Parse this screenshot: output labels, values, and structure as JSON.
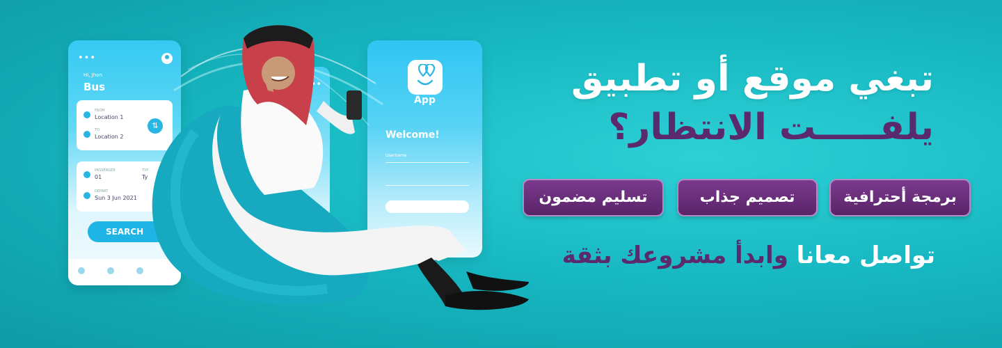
{
  "bus_app": {
    "menu_dots": "•••",
    "greeting": "Hi, Jhon",
    "title": "Bus",
    "from_label": "FROM",
    "from_value": "Location 1",
    "to_label": "TO",
    "to_value": "Location 2",
    "passenger_label": "PASSENGER",
    "passenger_value": "01",
    "type_label": "TYP",
    "type_value": "Ty",
    "depart_label": "DEPART",
    "depart_value": "Sun 3 Jun 2021",
    "search_label": "SEARCH"
  },
  "mid_app": {
    "menu_dots": "•••"
  },
  "login_app": {
    "app_name": "App",
    "welcome": "Welcome!",
    "username_label": "Username"
  },
  "headline": {
    "line1": "تبغي موقع أو تطبيق",
    "line2": "يلفـــــت الانتظار؟"
  },
  "features": [
    {
      "label": "برمجة أحترافية"
    },
    {
      "label": "تصميم جذاب"
    },
    {
      "label": "تسليم مضمون"
    }
  ],
  "cta": {
    "white_part": "تواصل معانا",
    "purple_part": "وابدأ مشروعك بثقة"
  },
  "colors": {
    "background": "#17b8c2",
    "accent_purple": "#5a2a6c",
    "app_blue": "#29b6e3"
  }
}
